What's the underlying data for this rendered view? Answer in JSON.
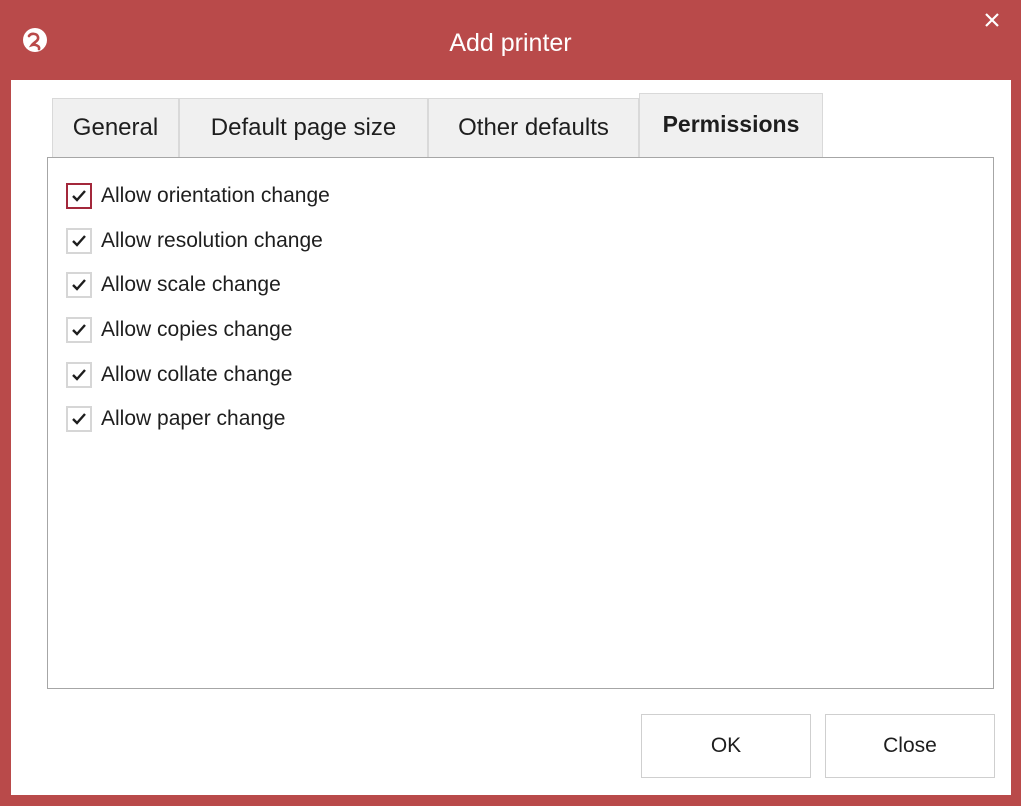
{
  "window": {
    "title": "Add printer",
    "app_icon": "printer-logo-icon",
    "close_icon": "close-icon",
    "accent_color": "#b94a4a"
  },
  "tabs": [
    {
      "label": "General",
      "active": false
    },
    {
      "label": "Default page size",
      "active": false
    },
    {
      "label": "Other defaults",
      "active": false
    },
    {
      "label": "Permissions",
      "active": true
    }
  ],
  "permissions": [
    {
      "label": "Allow orientation change",
      "checked": true,
      "focused": true
    },
    {
      "label": "Allow resolution change",
      "checked": true,
      "focused": false
    },
    {
      "label": "Allow scale change",
      "checked": true,
      "focused": false
    },
    {
      "label": "Allow copies change",
      "checked": true,
      "focused": false
    },
    {
      "label": "Allow collate change",
      "checked": true,
      "focused": false
    },
    {
      "label": "Allow paper change",
      "checked": true,
      "focused": false
    }
  ],
  "buttons": {
    "ok_label": "OK",
    "close_label": "Close"
  }
}
